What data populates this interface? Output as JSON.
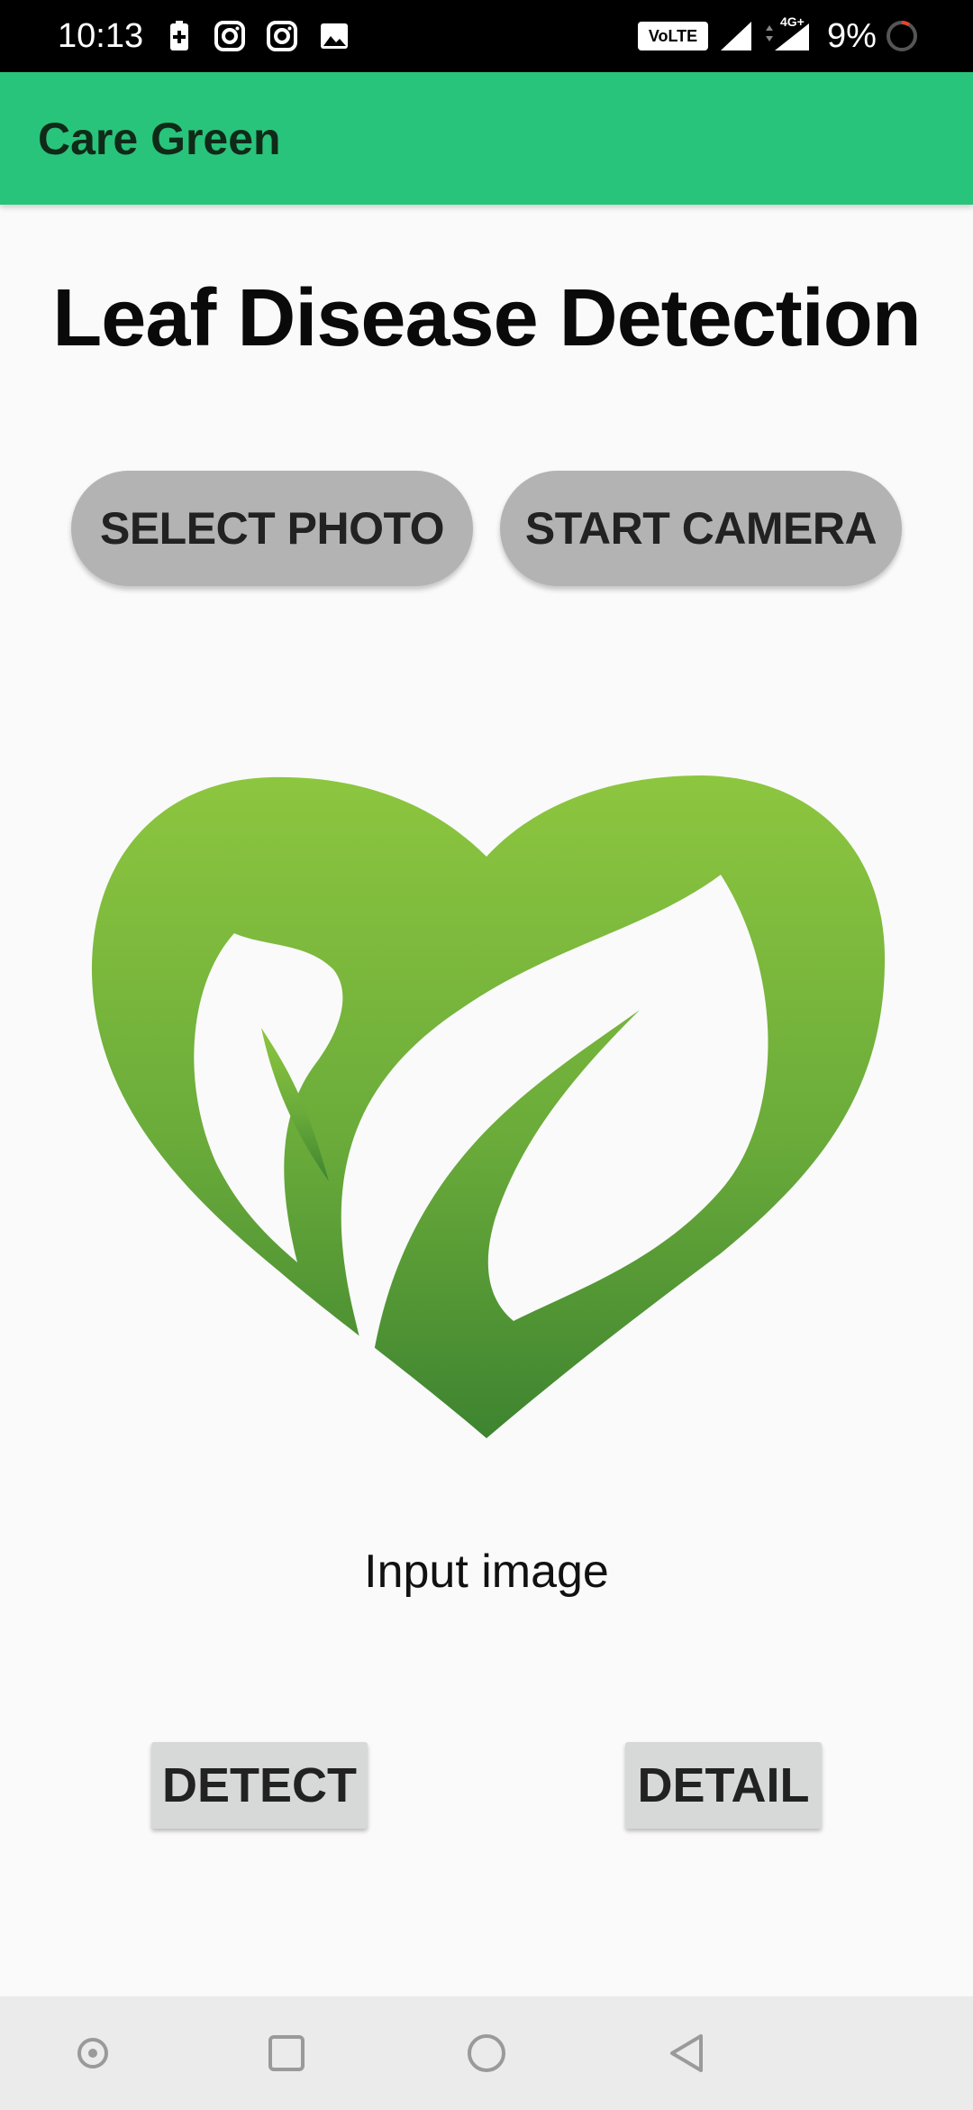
{
  "status_bar": {
    "time": "10:13",
    "network_badge": "VoLTE",
    "network_type": "4G+",
    "battery_percent": "9%",
    "icons": [
      "battery-saver-icon",
      "instagram-icon",
      "instagram-icon",
      "image-icon",
      "signal-icon",
      "battery-ring-icon"
    ]
  },
  "app_bar": {
    "title": "Care Green",
    "color": "#29c47b"
  },
  "main": {
    "heading": "Leaf Disease Detection",
    "select_photo_label": "SELECT PHOTO",
    "start_camera_label": "START CAMERA",
    "image_icon": "heart-leaf-logo",
    "image_caption": "Input image",
    "detect_label": "DETECT",
    "detail_label": "DETAIL"
  },
  "nav_bar": {
    "icons": [
      "dot-circle-icon",
      "recents-square-icon",
      "home-circle-icon",
      "back-triangle-icon"
    ]
  }
}
